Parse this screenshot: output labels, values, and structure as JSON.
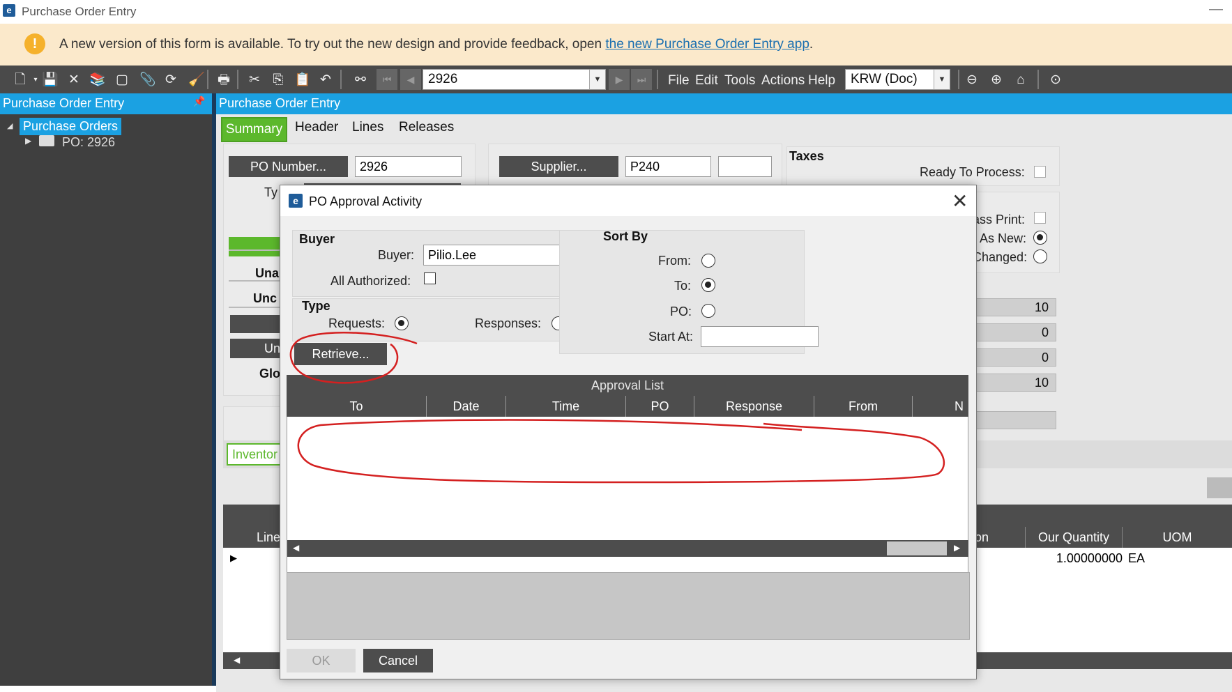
{
  "window": {
    "title": "Purchase Order Entry",
    "logo": "e"
  },
  "banner": {
    "message": "A new version of this form is available. To try out the new design and provide feedback, open",
    "link": "the new Purchase Order Entry app",
    "suffix": ".",
    "icon": "warning-icon",
    "icon_glyph": "!"
  },
  "toolbar": {
    "po_value": "2926",
    "menus": [
      "File",
      "Edit",
      "Tools",
      "Actions",
      "Help"
    ],
    "company": "KRW (Doc)"
  },
  "tree": {
    "header": "Purchase Order Entry",
    "root": "Purchase Orders",
    "child": "PO: 2926"
  },
  "main": {
    "header": "Purchase Order Entry",
    "tabs": [
      "Summary",
      "Header",
      "Lines",
      "Releases"
    ],
    "po_number_button": "PO Number...",
    "po_number_value": "2926",
    "supplier_button": "Supplier...",
    "supplier_value": "P240",
    "type_label_partial": "Ty",
    "taxes_label": "Taxes",
    "ready_to_process": "Ready To Process:",
    "print_as": "ass Print:",
    "as_new": "As New:",
    "changed": "Changed:",
    "left_labels": [
      "Una",
      "Unc",
      "Un",
      "Glo"
    ],
    "totals": [
      "10",
      "0",
      "0",
      "10"
    ],
    "inventory_tab": "Inventor",
    "grid_headers": {
      "line": "Line",
      "on": "on",
      "our_quantity": "Our Quantity",
      "uom": "UOM"
    },
    "grid_row": {
      "our_quantity": "1.00000000",
      "uom": "EA"
    }
  },
  "dialog": {
    "title": "PO Approval Activity",
    "buyer_group": "Buyer",
    "buyer_label": "Buyer:",
    "buyer_value": "Pilio.Lee",
    "all_authorized": "All Authorized:",
    "type_group": "Type",
    "requests": "Requests:",
    "responses": "Responses:",
    "retrieve_button": "Retrieve...",
    "sort_group": "Sort By",
    "sort_from": "From:",
    "sort_to": "To:",
    "sort_po": "PO:",
    "start_at": "Start At:",
    "start_at_value": "",
    "approval_list_title": "Approval List",
    "columns": [
      "To",
      "Date",
      "Time",
      "PO",
      "Response",
      "From",
      "N"
    ],
    "ok_button": "OK",
    "cancel_button": "Cancel",
    "state": {
      "all_authorized": false,
      "type": "requests",
      "sort_by": "to"
    }
  },
  "annotations": {
    "color": "#d42020"
  },
  "colors": {
    "accent": "#1ba1e2",
    "green_tab": "#5cb82c",
    "dark": "#4d4d4d",
    "banner": "#fbe9cb"
  }
}
